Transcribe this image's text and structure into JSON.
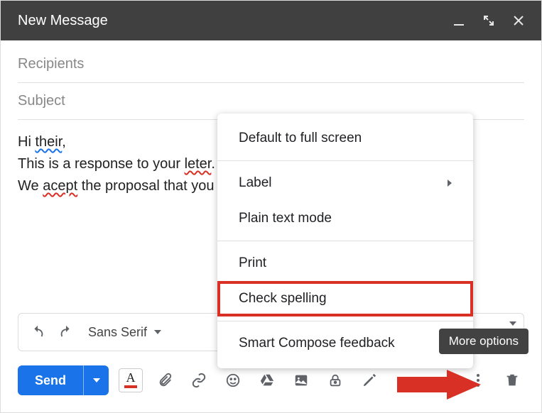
{
  "titlebar": {
    "title": "New Message"
  },
  "fields": {
    "recipients_placeholder": "Recipients",
    "subject_placeholder": "Subject"
  },
  "body": {
    "line1_prefix": "Hi ",
    "line1_err": "their",
    "line1_suffix": ",",
    "line2_prefix": "This is a response to your ",
    "line2_err": "leter",
    "line2_suffix": ".",
    "line3_prefix": "We ",
    "line3_err": "acept",
    "line3_suffix": " the proposal that you "
  },
  "format": {
    "font": "Sans Serif"
  },
  "send": {
    "label": "Send"
  },
  "textcolor": {
    "letter": "A",
    "bar_color": "#d93025"
  },
  "menu": {
    "default_fullscreen": "Default to full screen",
    "label": "Label",
    "plain_text": "Plain text mode",
    "print": "Print",
    "check_spelling": "Check spelling",
    "smart_compose": "Smart Compose feedback"
  },
  "tooltip": {
    "text": "More options"
  }
}
